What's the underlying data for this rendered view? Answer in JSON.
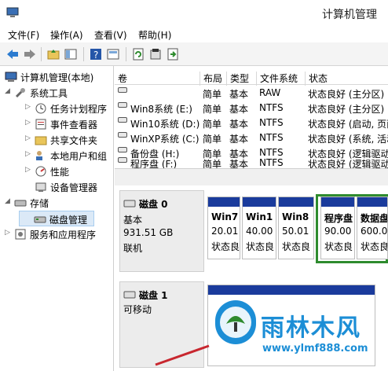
{
  "window": {
    "title": "计算机管理"
  },
  "menu": [
    "文件(F)",
    "操作(A)",
    "查看(V)",
    "帮助(H)"
  ],
  "toolbar": {
    "icons": [
      "back-arrow-icon",
      "forward-arrow-icon",
      "up-folder-icon",
      "show-tree-icon",
      "help-icon",
      "console-icon",
      "refresh-icon",
      "properties-icon",
      "export-icon"
    ]
  },
  "tree": {
    "root": "计算机管理(本地)",
    "items": [
      {
        "label": "系统工具"
      },
      {
        "label": "任务计划程序"
      },
      {
        "label": "事件查看器"
      },
      {
        "label": "共享文件夹"
      },
      {
        "label": "本地用户和组"
      },
      {
        "label": "性能"
      },
      {
        "label": "设备管理器"
      },
      {
        "label": "存储"
      },
      {
        "label": "磁盘管理"
      },
      {
        "label": "服务和应用程序"
      }
    ]
  },
  "volumes": {
    "headers": [
      "卷",
      "布局",
      "类型",
      "文件系统",
      "状态"
    ],
    "rows": [
      {
        "name": "",
        "layout": "简单",
        "type": "基本",
        "fs": "RAW",
        "status": "状态良好 (主分区)"
      },
      {
        "name": "Win8系统 (E:)",
        "layout": "简单",
        "type": "基本",
        "fs": "NTFS",
        "status": "状态良好 (主分区)"
      },
      {
        "name": "Win10系统 (D:)",
        "layout": "简单",
        "type": "基本",
        "fs": "NTFS",
        "status": "状态良好 (启动, 页面"
      },
      {
        "name": "WinXP系统 (C:)",
        "layout": "简单",
        "type": "基本",
        "fs": "NTFS",
        "status": "状态良好 (系统, 活动"
      },
      {
        "name": "备份盘 (H:)",
        "layout": "简单",
        "type": "基本",
        "fs": "NTFS",
        "status": "状态良好 (逻辑驱动"
      },
      {
        "name": "程序盘 (F:)",
        "layout": "简单",
        "type": "基本",
        "fs": "NTFS",
        "status": "状态良好 (逻辑驱动"
      }
    ]
  },
  "disks": [
    {
      "name": "磁盘 0",
      "type": "基本",
      "size": "931.51 GB",
      "state": "联机",
      "partitions": [
        {
          "name": "Win7",
          "size": "20.01",
          "status": "状态良"
        },
        {
          "name": "Win1",
          "size": "40.00",
          "status": "状态良"
        },
        {
          "name": "Win8",
          "size": "50.01",
          "status": "状态良"
        },
        {
          "name": "程序盘",
          "size": "90.00",
          "status": "状态良"
        },
        {
          "name": "数据盘",
          "size": "600.0",
          "status": "状态良"
        }
      ]
    },
    {
      "name": "磁盘 1",
      "type": "可移动"
    }
  ],
  "watermark": {
    "brand": "雨林木风",
    "url": "www.ylmf888.com"
  },
  "colors": {
    "partition_bar": "#1a3b9c",
    "extended_border": "#2e8b2e",
    "watermark": "#1c8ed6"
  }
}
